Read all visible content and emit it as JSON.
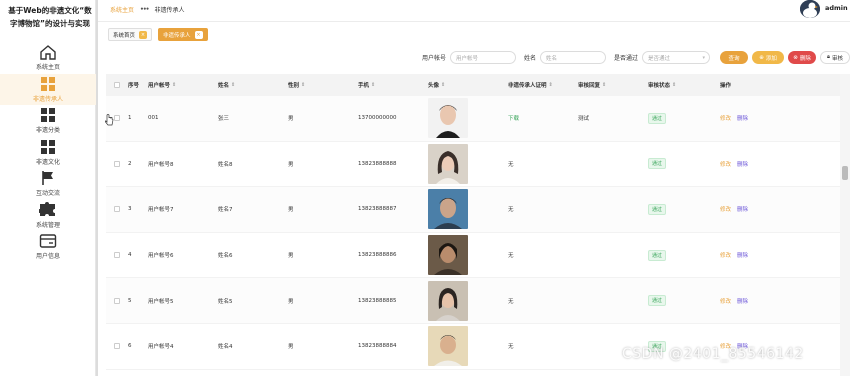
{
  "app": {
    "title_line1": "基于Web的非遗文化“数",
    "title_line2": "字博物馆”的设计与实现"
  },
  "sidebar": {
    "items": [
      {
        "label": "系统主页",
        "icon": "home-icon",
        "active": false
      },
      {
        "label": "非遗传承人",
        "icon": "grid-icon",
        "active": true
      },
      {
        "label": "非遗分类",
        "icon": "grid-icon",
        "active": false
      },
      {
        "label": "非遗文化",
        "icon": "grid-icon",
        "active": false
      },
      {
        "label": "互动交流",
        "icon": "flag-icon",
        "active": false
      },
      {
        "label": "系统管理",
        "icon": "puzzle-icon",
        "active": false
      },
      {
        "label": "用户信息",
        "icon": "card-icon",
        "active": false
      }
    ]
  },
  "topbar": {
    "breadcrumb_home": "系统主页",
    "breadcrumb_sep": "•••",
    "breadcrumb_current": "非遗传承人",
    "username": "admin"
  },
  "tabs": [
    {
      "label": "系统首页",
      "active": false
    },
    {
      "label": "非遗传承人",
      "active": true
    }
  ],
  "search": {
    "account_label": "用户帐号",
    "account_placeholder": "用户帐号",
    "name_label": "姓名",
    "name_placeholder": "姓名",
    "pass_label": "是否通过",
    "pass_placeholder": "是否通过",
    "btn_search": "查询",
    "btn_add": "添加",
    "btn_delete": "删除",
    "btn_audit": "审核"
  },
  "table": {
    "headers": [
      "序号",
      "用户帐号",
      "姓名",
      "性别",
      "手机",
      "头像",
      "非遗传承人证明",
      "审核回复",
      "审核状态",
      "操作"
    ],
    "rows": [
      {
        "no": "1",
        "account": "001",
        "name": "张三",
        "sex": "男",
        "phone": "13700000000",
        "cert": "下载",
        "reply": "测试",
        "status": "通过"
      },
      {
        "no": "2",
        "account": "用户帐号8",
        "name": "姓名8",
        "sex": "男",
        "phone": "13823888888",
        "cert": "无",
        "reply": "",
        "status": "通过"
      },
      {
        "no": "3",
        "account": "用户帐号7",
        "name": "姓名7",
        "sex": "男",
        "phone": "13823888887",
        "cert": "无",
        "reply": "",
        "status": "通过"
      },
      {
        "no": "4",
        "account": "用户帐号6",
        "name": "姓名6",
        "sex": "男",
        "phone": "13823888886",
        "cert": "无",
        "reply": "",
        "status": "通过"
      },
      {
        "no": "5",
        "account": "用户帐号5",
        "name": "姓名5",
        "sex": "男",
        "phone": "13823888885",
        "cert": "无",
        "reply": "",
        "status": "通过"
      },
      {
        "no": "6",
        "account": "用户帐号4",
        "name": "姓名4",
        "sex": "男",
        "phone": "13823888884",
        "cert": "无",
        "reply": "",
        "status": "通过"
      }
    ],
    "edit_label": "修改",
    "delete_label": "删除"
  },
  "colors": {
    "accent": "#e8a23c",
    "danger": "#e04a4a",
    "link_purple": "#6b55d8",
    "success": "#3aa55b"
  },
  "watermark": "CSDN @2401_85546142"
}
